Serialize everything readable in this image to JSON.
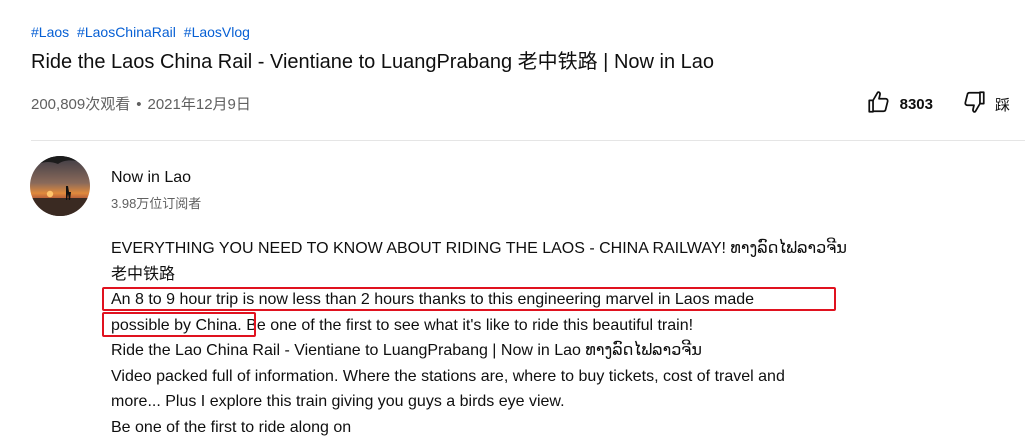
{
  "video": {
    "hashtags": [
      "#Laos",
      "#LaosChinaRail",
      "#LaosVlog"
    ],
    "title": "Ride the Laos China Rail - Vientiane to LuangPrabang 老中铁路 | Now in Lao",
    "views": "200,809次观看",
    "separator": "•",
    "date": "2021年12月9日",
    "like_count": "8303",
    "dislike_label": "踩"
  },
  "channel": {
    "name": "Now in Lao",
    "subscribers": "3.98万位订阅者"
  },
  "description": {
    "lines": [
      "EVERYTHING YOU NEED TO KNOW ABOUT RIDING THE LAOS - CHINA RAILWAY! ທາງລົດໄຟລາວຈີນ",
      "老中铁路",
      "An 8 to 9 hour trip is now less than 2 hours thanks to this engineering marvel in Laos made",
      "possible by China.",
      "Ride the Lao China Rail - Vientiane to LuangPrabang | Now in Lao ທາງລົດໄຟລາວຈີນ",
      "Video packed full of information. Where the stations are, where to buy tickets, cost of travel and",
      "more...  Plus I explore this train giving you guys a birds eye view.",
      "Be one of the first to ride along on"
    ],
    "line4_tail": " Be one of the first to see what it's like to ride this beautiful train!"
  },
  "colors": {
    "hashtag": "#065fd4",
    "highlight_box": "#e0121f",
    "meta_text": "#606060"
  },
  "icons": {
    "like": "thumbs-up-icon",
    "dislike": "thumbs-down-icon"
  }
}
